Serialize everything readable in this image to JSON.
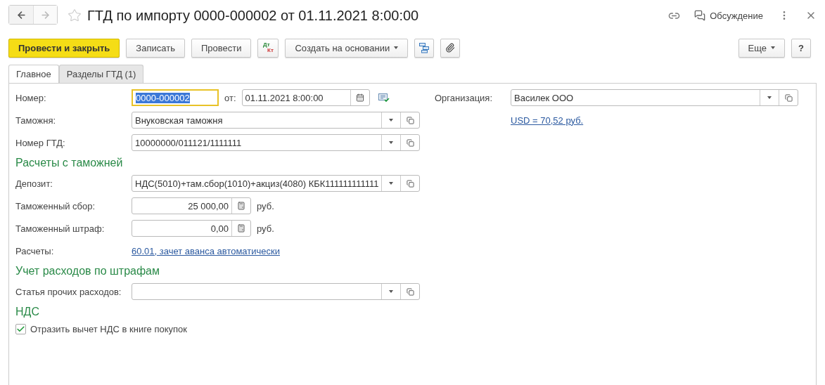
{
  "window": {
    "title": "ГТД по импорту 0000-000002 от 01.11.2021 8:00:00",
    "back_disabled": false,
    "forward_disabled": true,
    "favorite": false
  },
  "header_actions": {
    "discussion": "Обсуждение"
  },
  "toolbar": {
    "buttons": [
      {
        "kind": "primary",
        "label": "Провести и закрыть"
      },
      {
        "kind": "plain",
        "label": "Записать"
      },
      {
        "kind": "plain",
        "label": "Провести"
      },
      {
        "kind": "dtkt",
        "top": "Дт",
        "bottom": "Кт"
      },
      {
        "kind": "menu",
        "label": "Создать на основании"
      },
      {
        "kind": "structure"
      },
      {
        "kind": "attach"
      }
    ],
    "more": "Еще",
    "help": "?"
  },
  "tabs": [
    {
      "label": "Главное",
      "selected": true
    },
    {
      "label": "Разделы ГТД (1)",
      "selected": false
    }
  ],
  "form": {
    "left": [
      {
        "kind": "number",
        "label": "Номер:",
        "value": "0000-000002",
        "focused": true,
        "date_label": "от:",
        "date": "01.11.2021  8:00:00"
      },
      {
        "kind": "select",
        "label": "Таможня:",
        "value": "Внуковская таможня"
      },
      {
        "kind": "select",
        "label": "Номер ГТД:",
        "value": "10000000/011121/1111111"
      },
      {
        "kind": "heading",
        "text": "Расчеты с таможней"
      },
      {
        "kind": "select",
        "label": "Депозит:",
        "value": "НДС(5010)+там.сбор(1010)+акциз(4080) КБК111111111111"
      },
      {
        "kind": "amount",
        "label": "Таможенный сбор:",
        "value": "25 000,00",
        "unit": "руб."
      },
      {
        "kind": "amount",
        "label": "Таможенный штраф:",
        "value": "0,00",
        "unit": "руб."
      },
      {
        "kind": "link",
        "label": "Расчеты:",
        "value": "60.01, зачет аванса автоматически"
      },
      {
        "kind": "heading",
        "text": "Учет расходов по штрафам"
      },
      {
        "kind": "select",
        "label": "Статья прочих расходов:"
      },
      {
        "kind": "heading",
        "text": "НДС"
      },
      {
        "kind": "checkbox",
        "label": "Отразить вычет НДС в книге покупок",
        "checked": true
      }
    ],
    "right": {
      "label": "Организация:",
      "value": "Василек ООО",
      "rate_link": "USD = 70,52 руб."
    }
  }
}
